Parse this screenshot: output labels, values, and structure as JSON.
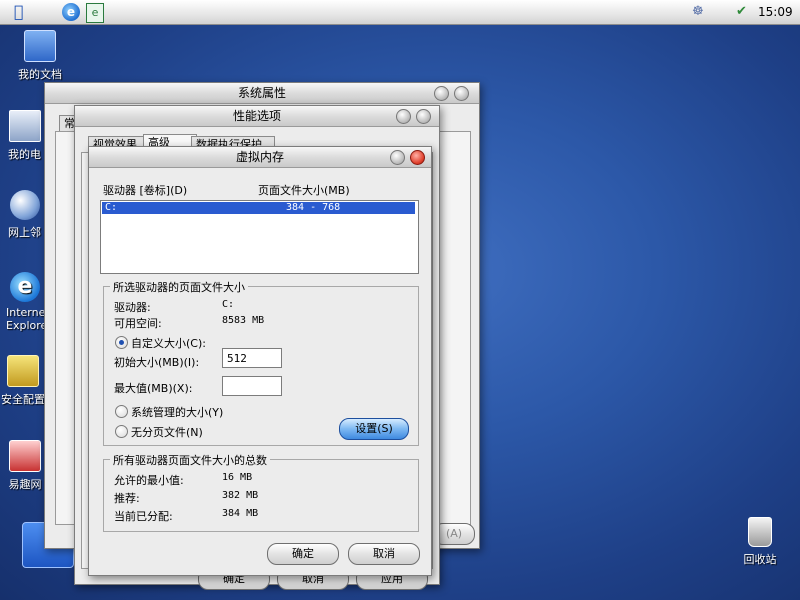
{
  "menubar": {
    "clock": "15:09"
  },
  "desktop": {
    "icons": [
      {
        "label": "我的文档"
      },
      {
        "label": "我的电"
      },
      {
        "label": "网上邻"
      },
      {
        "label": "Internet Explorer"
      },
      {
        "label": "安全配置"
      },
      {
        "label": "易趣网"
      },
      {
        "label": "回收站"
      }
    ]
  },
  "sysprops": {
    "title": "系统属性",
    "tab_visible": "常",
    "bottom_button": "(A)"
  },
  "perfopts": {
    "title": "性能选项",
    "tabs": [
      "视觉效果",
      "高级",
      "数据执行保护"
    ],
    "buttons": [
      "确定",
      "取消",
      "应用"
    ]
  },
  "vmem": {
    "title": "虚拟内存",
    "col_drive": "驱动器 [卷标](D)",
    "col_pagefile": "页面文件大小(MB)",
    "drives": [
      {
        "drive": "C:",
        "size": "384 - 768"
      }
    ],
    "selected_group": {
      "legend": "所选驱动器的页面文件大小",
      "drive_label": "驱动器:",
      "drive_value": "C:",
      "free_label": "可用空间:",
      "free_value": "8583 MB",
      "custom_label": "自定义大小(C):",
      "initial_label": "初始大小(MB)(I):",
      "initial_value": "512",
      "max_label": "最大值(MB)(X):",
      "max_value": "",
      "system_managed_label": "系统管理的大小(Y)",
      "no_paging_label": "无分页文件(N)",
      "set_button": "设置(S)"
    },
    "totals_group": {
      "legend": "所有驱动器页面文件大小的总数",
      "min_label": "允许的最小值:",
      "min_value": "16 MB",
      "recommended_label": "推荐:",
      "recommended_value": "382 MB",
      "current_label": "当前已分配:",
      "current_value": "384 MB"
    },
    "ok_button": "确定",
    "cancel_button": "取消"
  }
}
